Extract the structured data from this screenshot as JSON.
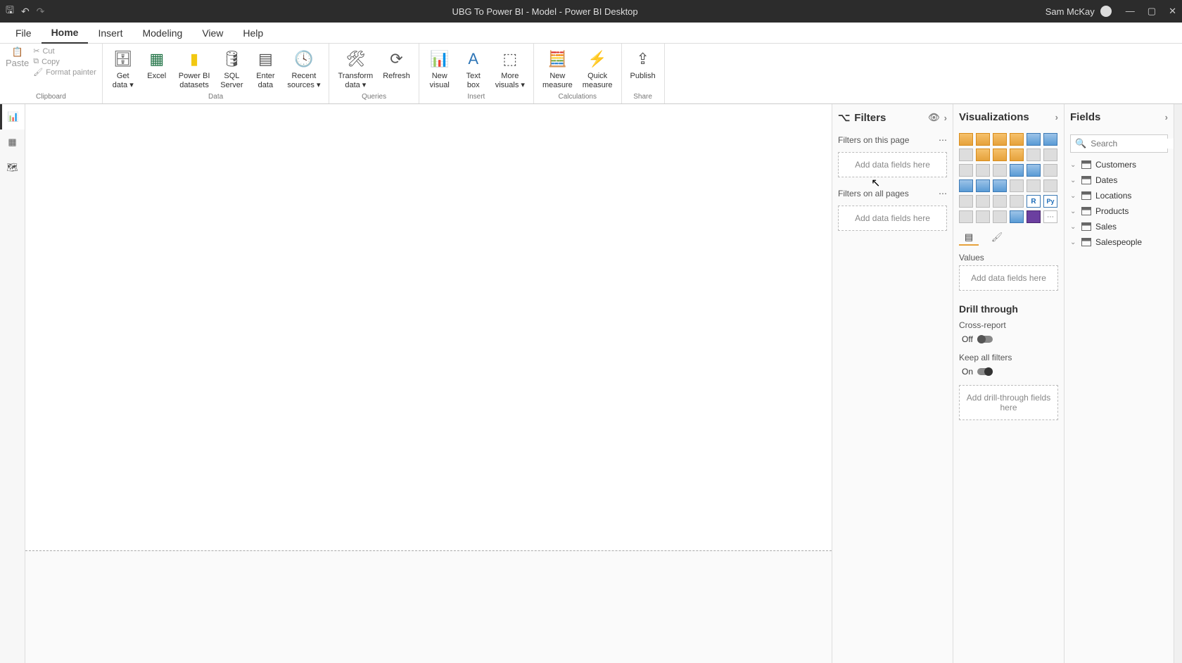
{
  "titlebar": {
    "title": "UBG To Power BI - Model - Power BI Desktop",
    "user": "Sam McKay"
  },
  "menu": {
    "items": [
      "File",
      "Home",
      "Insert",
      "Modeling",
      "View",
      "Help"
    ],
    "active": "Home"
  },
  "ribbon": {
    "clipboard": {
      "paste": "Paste",
      "cut": "Cut",
      "copy": "Copy",
      "format_painter": "Format painter",
      "group": "Clipboard"
    },
    "data": {
      "get_data": "Get\ndata ▾",
      "excel": "Excel",
      "pbi_datasets": "Power BI\ndatasets",
      "sql": "SQL\nServer",
      "enter_data": "Enter\ndata",
      "recent_sources": "Recent\nsources ▾",
      "group": "Data"
    },
    "queries": {
      "transform": "Transform\ndata ▾",
      "refresh": "Refresh",
      "group": "Queries"
    },
    "insert": {
      "new_visual": "New\nvisual",
      "text_box": "Text\nbox",
      "more_visuals": "More\nvisuals ▾",
      "group": "Insert"
    },
    "calculations": {
      "new_measure": "New\nmeasure",
      "quick_measure": "Quick\nmeasure",
      "group": "Calculations"
    },
    "share": {
      "publish": "Publish",
      "group": "Share"
    }
  },
  "filters": {
    "header": "Filters",
    "on_page": "Filters on this page",
    "on_all": "Filters on all pages",
    "drop": "Add data fields here"
  },
  "viz": {
    "header": "Visualizations",
    "values_label": "Values",
    "values_drop": "Add data fields here",
    "drill_header": "Drill through",
    "cross_report": "Cross-report",
    "cross_report_state": "Off",
    "keep_filters": "Keep all filters",
    "keep_filters_state": "On",
    "drill_drop": "Add drill-through fields here"
  },
  "fields": {
    "header": "Fields",
    "search_placeholder": "Search",
    "tables": [
      "Customers",
      "Dates",
      "Locations",
      "Products",
      "Sales",
      "Salespeople"
    ]
  }
}
